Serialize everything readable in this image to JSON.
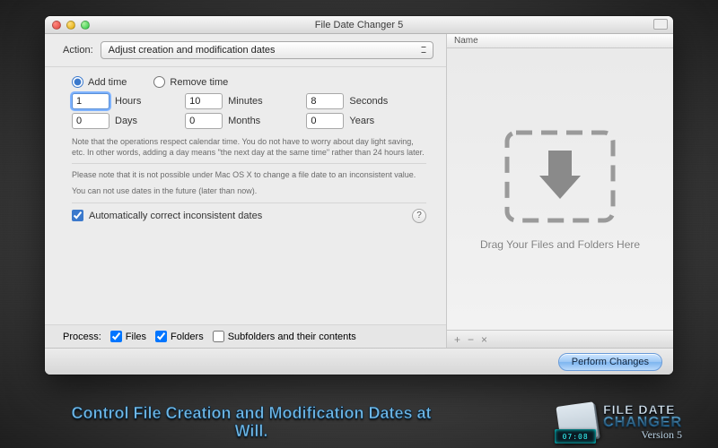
{
  "window": {
    "title": "File Date Changer 5"
  },
  "action": {
    "label": "Action:",
    "selected": "Adjust creation and modification dates"
  },
  "mode": {
    "add_label": "Add time",
    "remove_label": "Remove time",
    "selected": "add"
  },
  "time": {
    "hours": "1",
    "hours_label": "Hours",
    "minutes": "10",
    "minutes_label": "Minutes",
    "seconds": "8",
    "seconds_label": "Seconds",
    "days": "0",
    "days_label": "Days",
    "months": "0",
    "months_label": "Months",
    "years": "0",
    "years_label": "Years"
  },
  "notes": {
    "n1": "Note that the operations respect calendar time. You do not have to worry about day light saving, etc. In other words, adding a day means \"the next day at the same time\" rather than 24 hours later.",
    "n2": "Please note that it is not possible under Mac OS X to change a file date to an inconsistent value.",
    "n3": "You can not use dates in the future (later than now)."
  },
  "auto_correct": {
    "label": "Automatically correct inconsistent dates",
    "checked": true
  },
  "help": "?",
  "process": {
    "label": "Process:",
    "files": {
      "label": "Files",
      "checked": true
    },
    "folders": {
      "label": "Folders",
      "checked": true
    },
    "subfolders": {
      "label": "Subfolders and their contents",
      "checked": false
    }
  },
  "right": {
    "header": "Name",
    "drop_label": "Drag Your Files and Folders Here",
    "footer_add": "+",
    "footer_remove": "−",
    "footer_clear": "×"
  },
  "perform": "Perform Changes",
  "promo": {
    "tagline": "Control File Creation and Modification Dates at Will.",
    "logo_line1": "FILE DATE",
    "logo_line2": "CHANGER",
    "logo_line3": "Version 5",
    "lcd": "07:08"
  }
}
